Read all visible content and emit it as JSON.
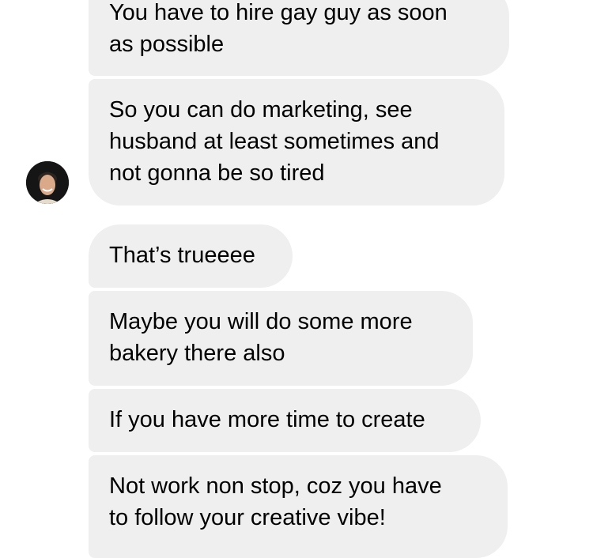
{
  "messages": [
    {
      "text": "You have to hire gay guy as soon\nas possible"
    },
    {
      "text": "So you can do marketing, see\nhusband at least sometimes and\nnot gonna be so tired"
    },
    {
      "text": "That’s trueeee"
    },
    {
      "text": "Maybe you will do some more\nbakery there also"
    },
    {
      "text": "If you have more time to create"
    },
    {
      "text": "Not work non stop, coz you have\nto follow your creative vibe!"
    }
  ],
  "bubble_color": "#efefef",
  "avatar": {
    "icon": "contact-avatar-photo"
  }
}
